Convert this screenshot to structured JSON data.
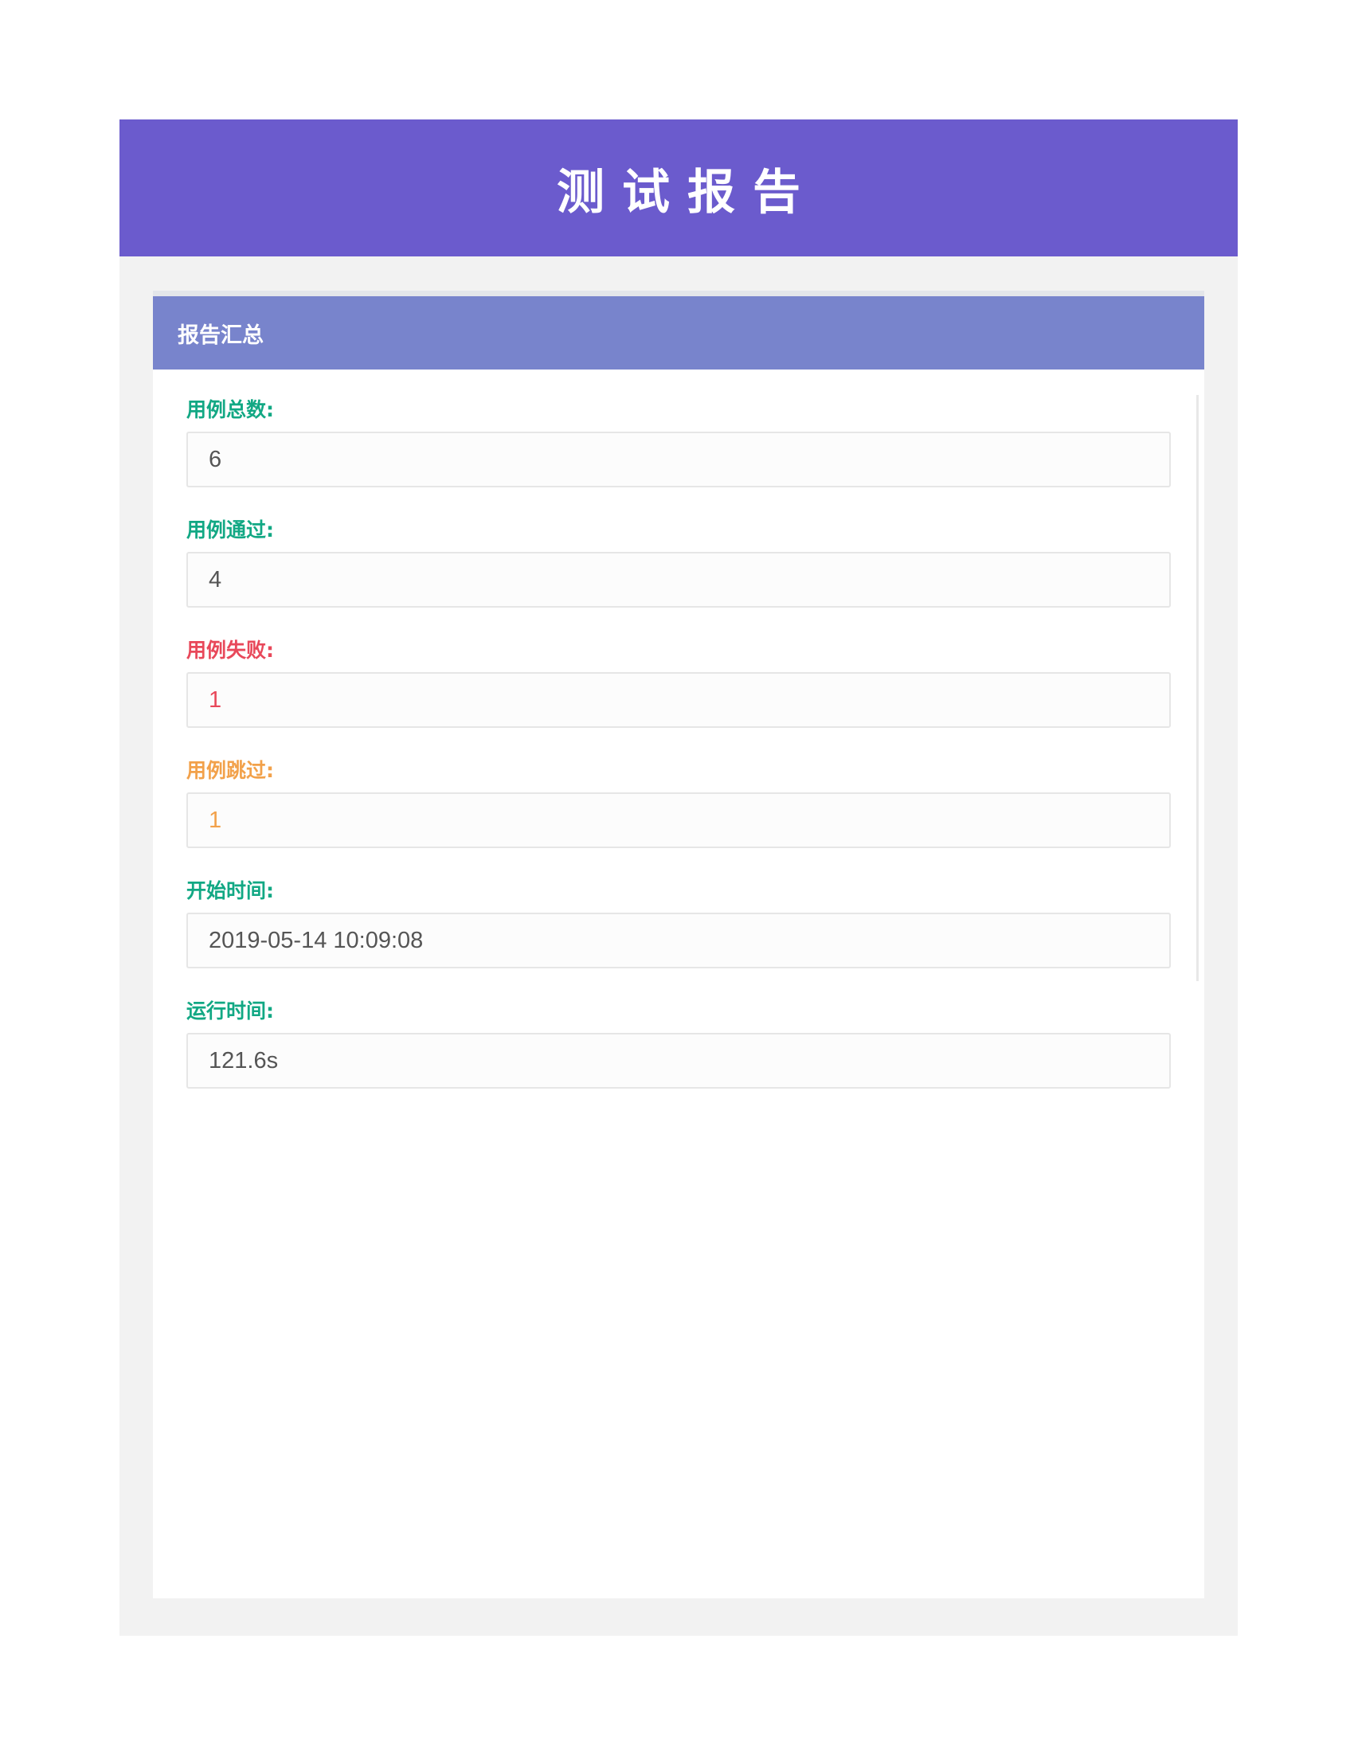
{
  "header": {
    "title": "测试报告"
  },
  "summary": {
    "heading": "报告汇总",
    "fields": [
      {
        "label": "用例总数:",
        "value": "6",
        "label_color": "#12a884",
        "value_color": "#555555"
      },
      {
        "label": "用例通过:",
        "value": "4",
        "label_color": "#12a884",
        "value_color": "#555555"
      },
      {
        "label": "用例失败:",
        "value": "1",
        "label_color": "#e8485a",
        "value_color": "#e8485a"
      },
      {
        "label": "用例跳过:",
        "value": "1",
        "label_color": "#f2a14a",
        "value_color": "#f2a14a"
      },
      {
        "label": "开始时间:",
        "value": "2019-05-14 10:09:08",
        "label_color": "#12a884",
        "value_color": "#555555"
      },
      {
        "label": "运行时间:",
        "value": "121.6s",
        "label_color": "#12a884",
        "value_color": "#555555"
      }
    ]
  },
  "colors": {
    "banner": "#6b5bcd",
    "panel_heading": "#7884cc",
    "page_background": "#f2f2f2"
  }
}
